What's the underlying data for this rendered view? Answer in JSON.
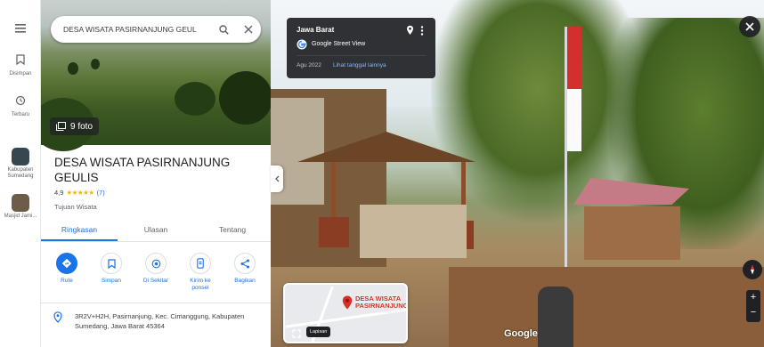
{
  "rail": {
    "menu_icon": "hamburger-icon",
    "saved_label": "Disimpan",
    "recent_label": "Terbaru",
    "recent_places": [
      {
        "label": "Kabupaten Sumedang",
        "color": "#37474f"
      },
      {
        "label": "Masjid Jami...",
        "color": "#6d5c4a"
      }
    ]
  },
  "search": {
    "value": "DESA WISATA PASIRNANJUNG GEUL",
    "search_icon": "search-icon",
    "clear_icon": "close-icon"
  },
  "photos": {
    "label": "9 foto"
  },
  "place": {
    "title": "DESA WISATA PASIRNANJUNG GEULIS",
    "rating": "4,9",
    "stars": "★★★★★",
    "reviews": "(7)",
    "category": "Tujuan Wisata"
  },
  "tabs": [
    "Ringkasan",
    "Ulasan",
    "Tentang"
  ],
  "actions": [
    {
      "label": "Rute",
      "icon": "directions-icon"
    },
    {
      "label": "Simpan",
      "icon": "bookmark-icon"
    },
    {
      "label": "Di Sekitar",
      "icon": "nearby-icon"
    },
    {
      "label": "Kirim ke ponsel",
      "icon": "phone-icon"
    },
    {
      "label": "Bagikan",
      "icon": "share-icon"
    }
  ],
  "address": "3R2V+H2H, Pasirnanjung, Kec. Cimanggung, Kabupaten Sumedang, Jawa Barat 45364",
  "street_view": {
    "region": "Jawa Barat",
    "source": "Google Street View",
    "date": "Agu 2022",
    "more_dates": "Lihat tanggal lainnya",
    "minimap_label": "DESA WISATA PASIRNANJUNG",
    "layer_label": "Lapisan",
    "logo": "Google"
  },
  "colors": {
    "accent": "#1a73e8",
    "star": "#f4b400",
    "pin": "#d93025",
    "card": "#202124"
  }
}
